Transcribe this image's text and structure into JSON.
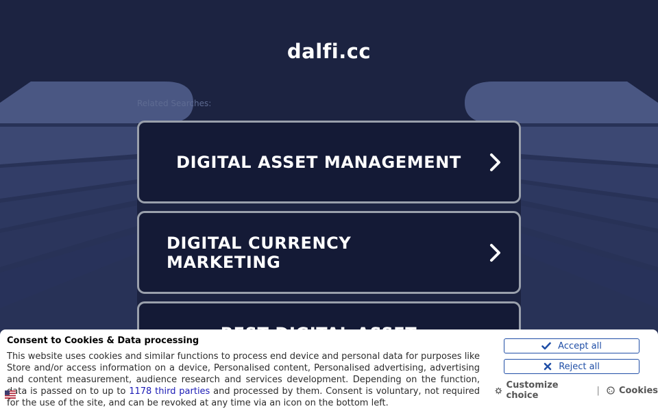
{
  "site": {
    "domain": "dalfi.cc",
    "related_label": "Related Searches:"
  },
  "cards": [
    {
      "label": "DIGITAL ASSET MANAGEMENT"
    },
    {
      "label": "DIGITAL CURRENCY MARKETING"
    },
    {
      "label": "BEST DIGITAL ASSET"
    }
  ],
  "consent": {
    "title": "Consent to Cookies & Data processing",
    "text_before": "This website uses cookies and similar functions to process end device and personal data for purposes like Store and/or access information on a device, Personalised content, Personalised advertising, advertising and content measurement, audience research and services development. Depending on the function, data is passed on to up to ",
    "link": "1178 third parties",
    "text_after": " and processed by them. Consent is voluntary, not required for the use of the site, and can be revoked at any time via an icon on the bottom left.",
    "accept_label": "Accept all",
    "reject_label": "Reject all",
    "customize_label": "Customize choice",
    "cookies_label": "Cookies"
  },
  "colors": {
    "background": "#1c2341",
    "card_bg": "#141a36",
    "card_border": "#9aa0ac",
    "button_accent": "#1f4ea6"
  },
  "icons": {
    "card_arrow": "chevron-right-icon",
    "accept": "check-icon",
    "reject": "x-icon",
    "customize": "gear-icon",
    "cookies": "cookie-icon",
    "language": "flag-icon"
  }
}
